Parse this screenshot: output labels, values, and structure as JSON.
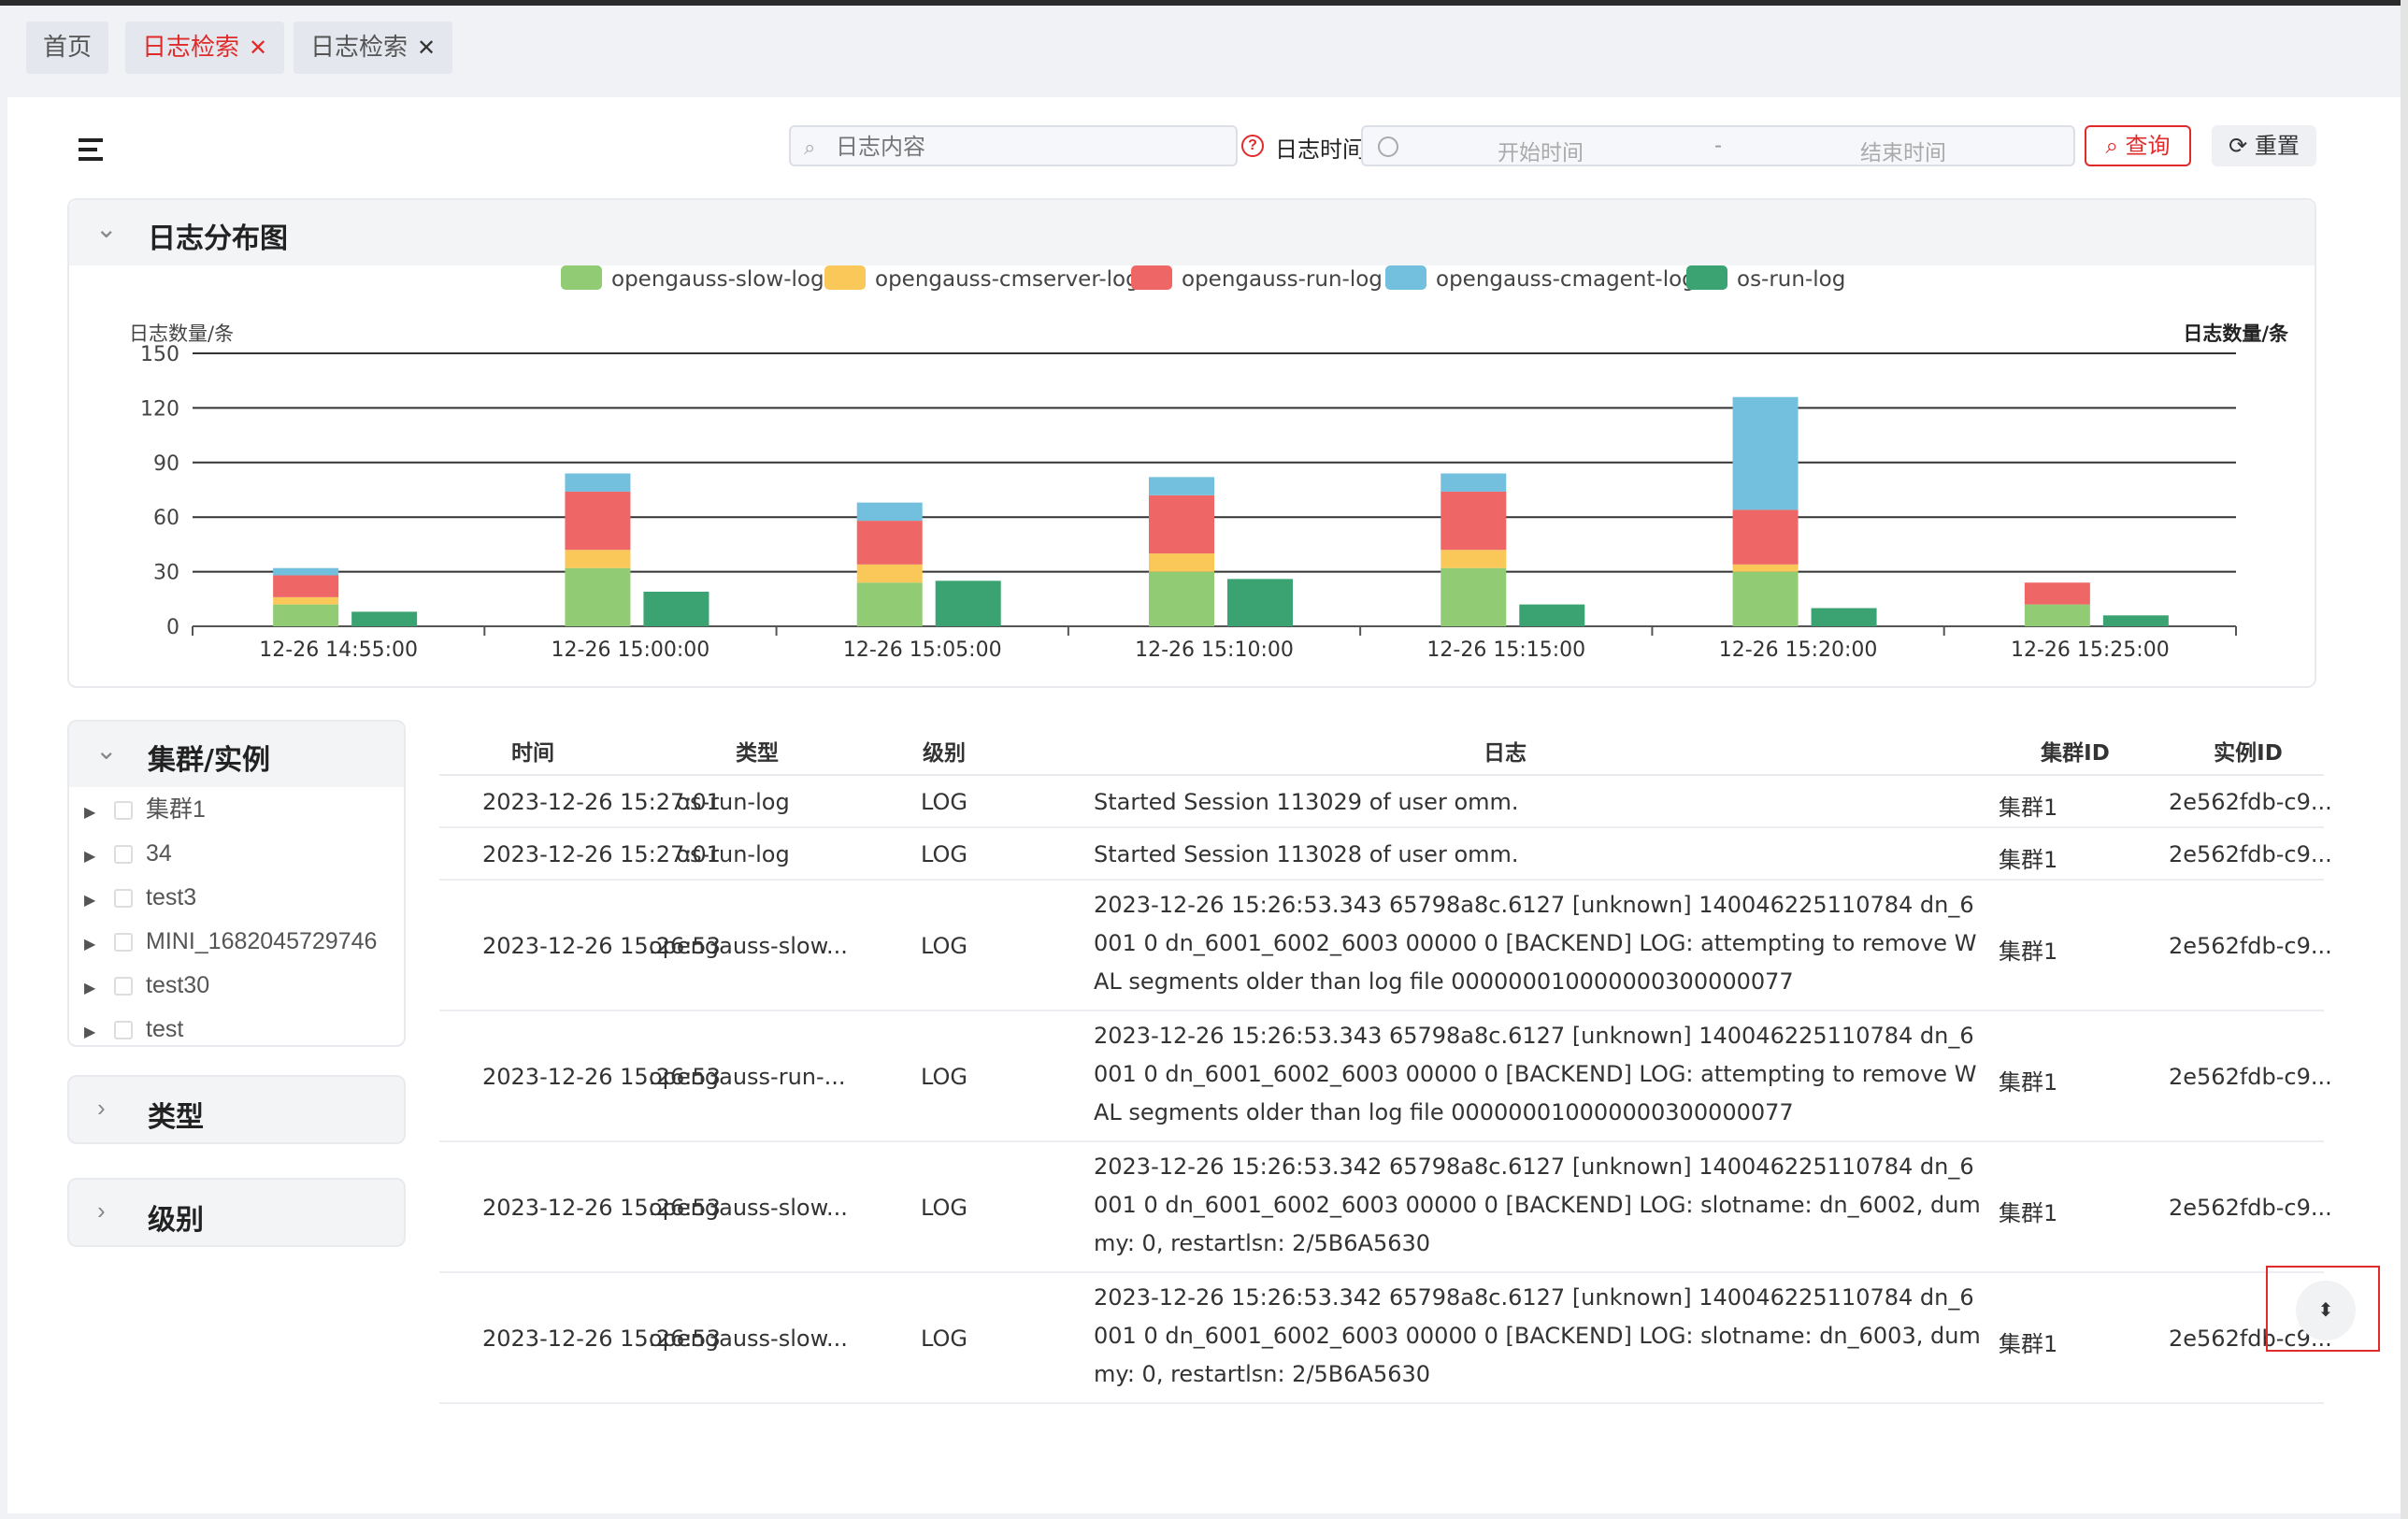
{
  "tabs": [
    {
      "label": "首页",
      "closable": false,
      "active": false
    },
    {
      "label": "日志检索",
      "closable": true,
      "active": true
    },
    {
      "label": "日志检索",
      "closable": true,
      "active": false
    }
  ],
  "toolbar": {
    "search_placeholder": "日志内容",
    "time_label": "日志时间",
    "start_placeholder": "开始时间",
    "range_separator": "-",
    "end_placeholder": "结束时间",
    "query_label": "查询",
    "reset_label": "重置"
  },
  "chart_panel": {
    "title": "日志分布图"
  },
  "chart_data": {
    "type": "bar",
    "stacked_group": [
      "opengauss-slow-log",
      "opengauss-cmserver-log",
      "opengauss-run-log",
      "opengauss-cmagent-log"
    ],
    "categories": [
      "12-26 14:55:00",
      "12-26 15:00:00",
      "12-26 15:05:00",
      "12-26 15:10:00",
      "12-26 15:15:00",
      "12-26 15:20:00",
      "12-26 15:25:00"
    ],
    "series": [
      {
        "name": "opengauss-slow-log",
        "color": "#91cc75",
        "values": [
          12,
          32,
          24,
          30,
          32,
          30,
          12
        ]
      },
      {
        "name": "opengauss-cmserver-log",
        "color": "#fac858",
        "values": [
          4,
          10,
          10,
          10,
          10,
          4,
          0
        ]
      },
      {
        "name": "opengauss-run-log",
        "color": "#ee6666",
        "values": [
          12,
          32,
          24,
          32,
          32,
          30,
          12
        ]
      },
      {
        "name": "opengauss-cmagent-log",
        "color": "#73c0de",
        "values": [
          4,
          10,
          10,
          10,
          10,
          62,
          0
        ]
      },
      {
        "name": "os-run-log",
        "color": "#3ba272",
        "values": [
          8,
          19,
          25,
          26,
          12,
          10,
          6
        ]
      }
    ],
    "ylabel_left": "日志数量/条",
    "ylabel_right": "日志数量/条",
    "yticks": [
      "0",
      "30",
      "60",
      "90",
      "120",
      "150"
    ],
    "ylim": [
      0,
      150
    ],
    "legend_position": "top-center",
    "grid": true
  },
  "cluster_panel": {
    "title": "集群/实例",
    "items": [
      "集群1",
      "34",
      "test3",
      "MINI_1682045729746",
      "test30",
      "test"
    ]
  },
  "type_panel": {
    "title": "类型"
  },
  "level_panel": {
    "title": "级别"
  },
  "table": {
    "headers": {
      "time": "时间",
      "type": "类型",
      "level": "级别",
      "log": "日志",
      "cluster": "集群ID",
      "instance": "实例ID"
    },
    "rows": [
      {
        "time": "2023-12-26 15:27:01",
        "type": "os-run-log",
        "level": "LOG",
        "log": "Started Session 113029 of user omm.",
        "cluster": "集群1",
        "instance": "2e562fdb-c9..."
      },
      {
        "time": "2023-12-26 15:27:01",
        "type": "os-run-log",
        "level": "LOG",
        "log": "Started Session 113028 of user omm.",
        "cluster": "集群1",
        "instance": "2e562fdb-c9..."
      },
      {
        "time": "2023-12-26 15:26:53",
        "type": "opengauss-slow...",
        "level": "LOG",
        "log": "2023-12-26 15:26:53.343 65798a8c.6127 [unknown] 140046225110784 dn_6001 0 dn_6001_6002_6003 00000 0 [BACKEND] LOG: attempting to remove WAL segments older than log file 000000010000000300000077",
        "cluster": "集群1",
        "instance": "2e562fdb-c9..."
      },
      {
        "time": "2023-12-26 15:26:53",
        "type": "opengauss-run-...",
        "level": "LOG",
        "log": "2023-12-26 15:26:53.343 65798a8c.6127 [unknown] 140046225110784 dn_6001 0 dn_6001_6002_6003 00000 0 [BACKEND] LOG: attempting to remove WAL segments older than log file 000000010000000300000077",
        "cluster": "集群1",
        "instance": "2e562fdb-c9..."
      },
      {
        "time": "2023-12-26 15:26:53",
        "type": "opengauss-slow...",
        "level": "LOG",
        "log": "2023-12-26 15:26:53.342 65798a8c.6127 [unknown] 140046225110784 dn_6001 0 dn_6001_6002_6003 00000 0 [BACKEND] LOG: slotname: dn_6002, dummy: 0, restartlsn: 2/5B6A5630",
        "cluster": "集群1",
        "instance": "2e562fdb-c9..."
      },
      {
        "time": "2023-12-26 15:26:53",
        "type": "opengauss-slow...",
        "level": "LOG",
        "log": "2023-12-26 15:26:53.342 65798a8c.6127 [unknown] 140046225110784 dn_6001 0 dn_6001_6002_6003 00000 0 [BACKEND] LOG: slotname: dn_6003, dummy: 0, restartlsn: 2/5B6A5630",
        "cluster": "集群1",
        "instance": "2e562fdb-c9..."
      }
    ]
  },
  "icons": {
    "menu": "hamburger-icon",
    "search": "search-icon",
    "help": "help-circle-icon",
    "clock": "clock-icon",
    "query": "search-icon",
    "reset": "refresh-icon",
    "float": "sort-arrows-icon"
  }
}
